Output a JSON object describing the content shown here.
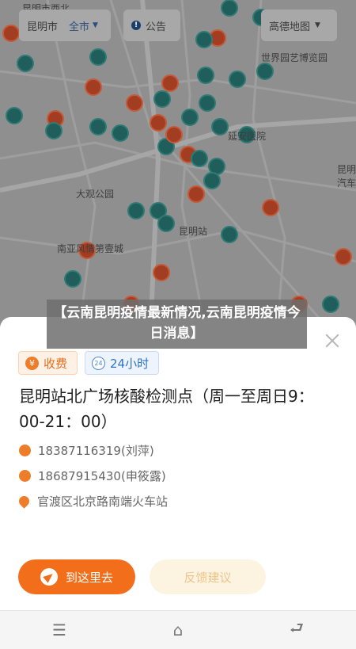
{
  "map": {
    "city": "昆明市",
    "scope": "全市",
    "notice_label": "公告",
    "provider": "高德地图",
    "labels": [
      "昆明市西北",
      "世界园艺博览园",
      "延安医院",
      "大观公园",
      "昆明站",
      "南亚风情第壹城",
      "昆明汽车"
    ],
    "pin_colors": {
      "testing_point": "#1f5e5a",
      "fee_point": "#a23d22"
    }
  },
  "headline": "【云南昆明疫情最新情况,云南昆明疫情今日消息】",
  "sheet": {
    "tags": [
      {
        "icon": "yen-icon",
        "label": "收费"
      },
      {
        "icon": "clock-24-icon",
        "label": "24小时"
      }
    ],
    "title": "昆明站北广场核酸检测点（周一至周日9：00-21：00）",
    "phone1": "18387116319(刘萍)",
    "phone2": "18687915430(申筱露)",
    "address": "官渡区北京路南端火车站",
    "go_button": "到这里去",
    "feedback_button": "反馈建议"
  },
  "navbar": {
    "menu": "☰",
    "home": "⌂",
    "back": "⮐"
  },
  "colors": {
    "accent": "#f36e1a",
    "tag_blue": "#2e72c4"
  }
}
